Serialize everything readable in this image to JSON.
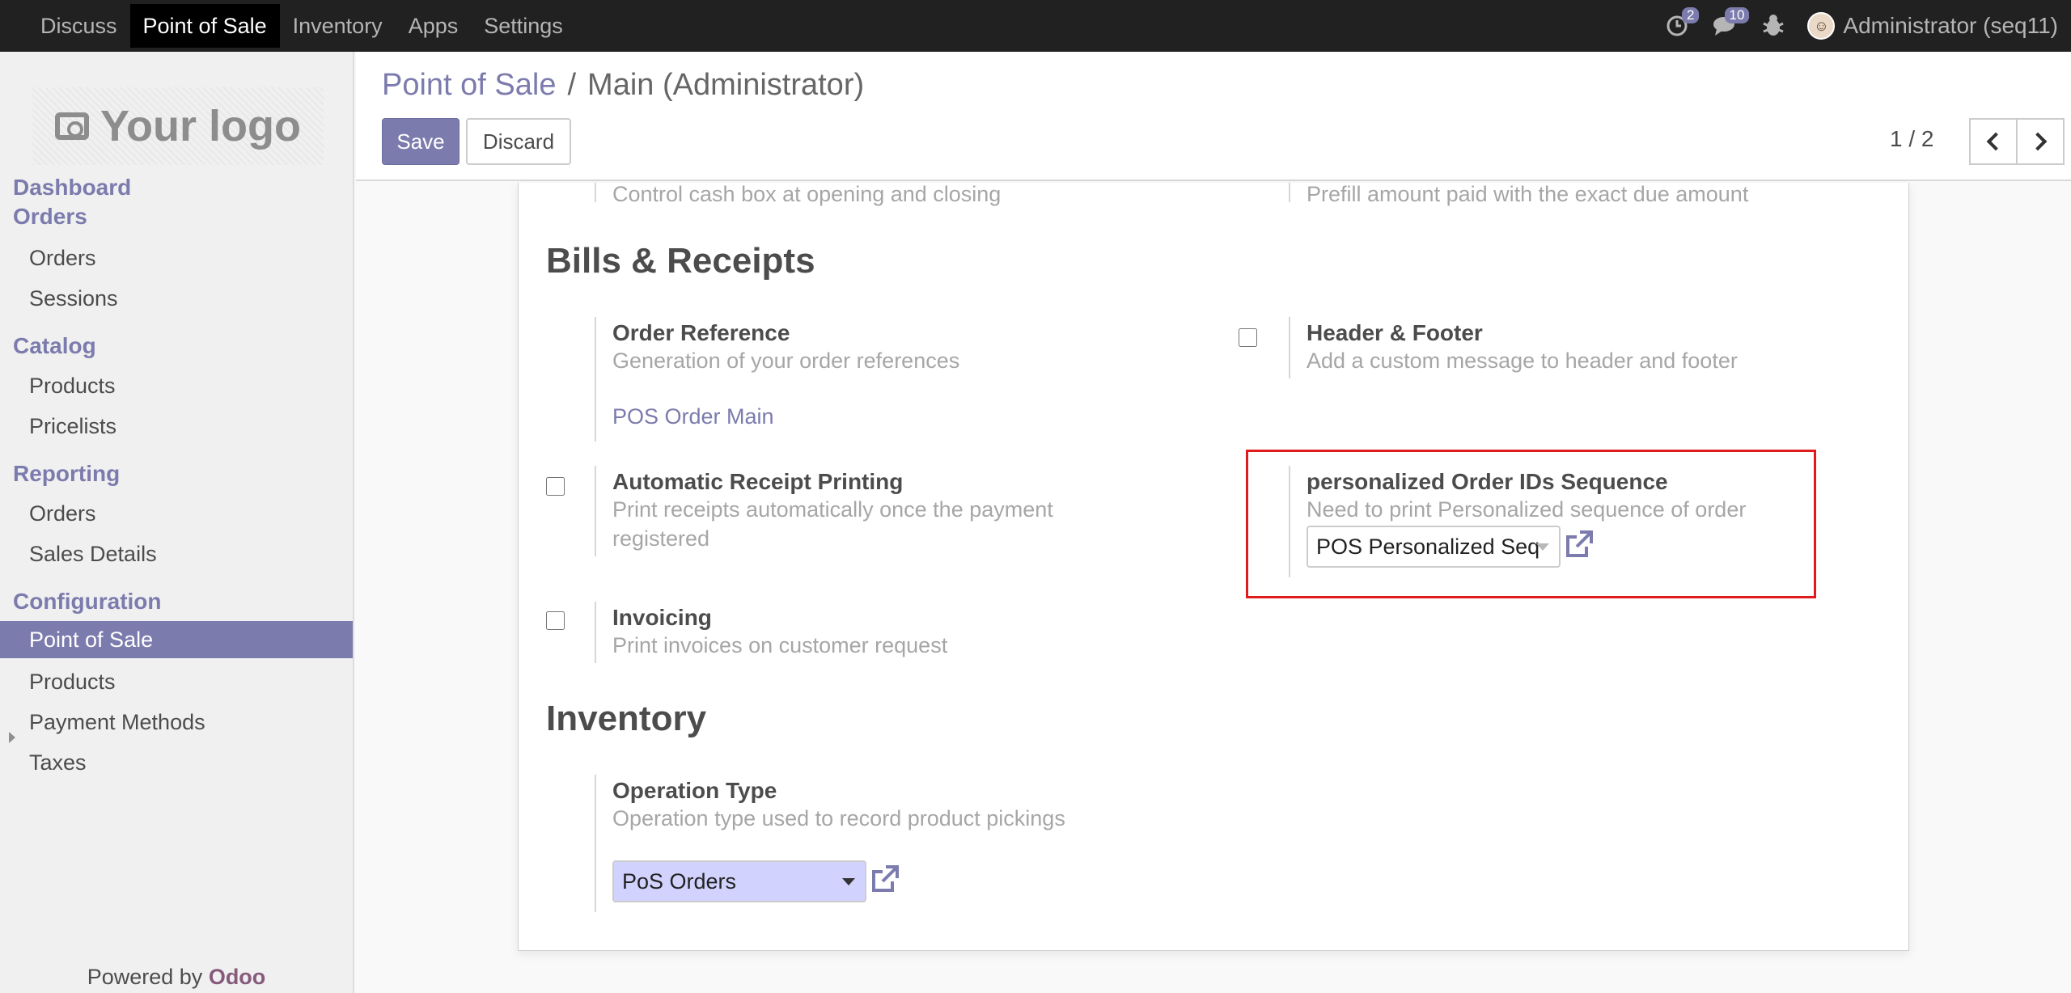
{
  "topbar": {
    "menu": [
      "Discuss",
      "Point of Sale",
      "Inventory",
      "Apps",
      "Settings"
    ],
    "active_index": 1,
    "activity_count": "2",
    "messages_count": "10",
    "user": "Administrator (seq11)"
  },
  "sidebar": {
    "logo_text": "Your logo",
    "sections": {
      "dashboard": "Dashboard",
      "orders": "Orders",
      "catalog": "Catalog",
      "reporting": "Reporting",
      "configuration": "Configuration"
    },
    "orders_items": [
      "Orders",
      "Sessions"
    ],
    "catalog_items": [
      "Products",
      "Pricelists"
    ],
    "reporting_items": [
      "Orders",
      "Sales Details"
    ],
    "configuration_items": [
      "Point of Sale",
      "Products",
      "Payment Methods",
      "Taxes"
    ],
    "powered_by": "Powered by",
    "brand": "Odoo"
  },
  "control": {
    "breadcrumb_parent": "Point of Sale",
    "breadcrumb_sep": "/",
    "breadcrumb_current": "Main (Administrator)",
    "save_label": "Save",
    "discard_label": "Discard",
    "pager": "1 / 2"
  },
  "form": {
    "cash_help": "Control cash box at opening and closing",
    "prefill_help": "Prefill amount paid with the exact due amount",
    "bills_title": "Bills & Receipts",
    "order_ref": {
      "label": "Order Reference",
      "help": "Generation of your order references",
      "link": "POS Order Main"
    },
    "header_footer": {
      "label": "Header & Footer",
      "help": "Add a custom message to header and footer",
      "checked": false
    },
    "auto_print": {
      "label": "Automatic Receipt Printing",
      "help_line1": "Print receipts automatically once the payment",
      "help_line2": "registered",
      "checked": false
    },
    "personalized": {
      "label": "personalized Order IDs Sequence",
      "help": "Need to print Personalized sequence of order",
      "value": "POS Personalized Seq"
    },
    "invoicing": {
      "label": "Invoicing",
      "help": "Print invoices on customer request",
      "checked": false
    },
    "inventory_title": "Inventory",
    "operation_type": {
      "label": "Operation Type",
      "help": "Operation type used to record product pickings",
      "value": "PoS Orders"
    }
  },
  "colors": {
    "accent": "#7c7bad",
    "highlight": "#e01b1b",
    "topbar": "#212121"
  }
}
